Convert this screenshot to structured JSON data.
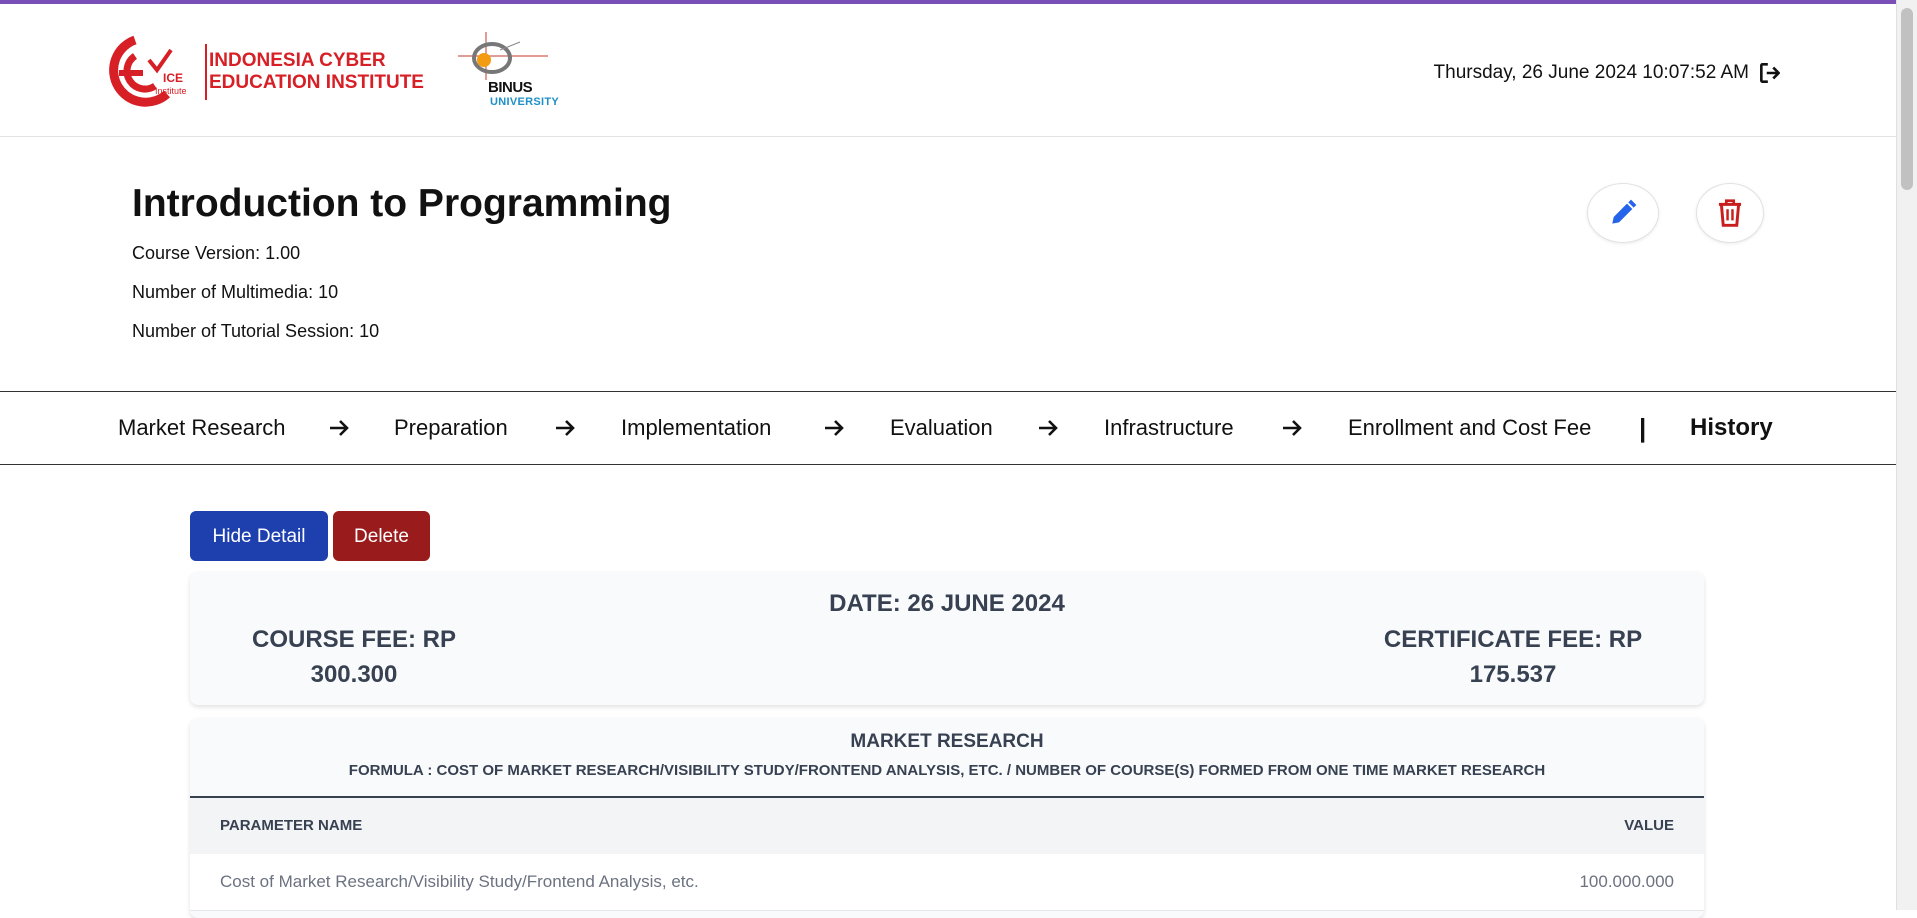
{
  "header": {
    "ice_logo": {
      "line1": "INDONESIA CYBER",
      "line2": "EDUCATION INSTITUTE",
      "mark_text_1": "ICE",
      "mark_text_2": "Institute"
    },
    "binus_logo": {
      "name": "BINUS",
      "sub": "UNIVERSITY"
    },
    "datetime": "Thursday, 26 June 2024 10:07:52 AM"
  },
  "course": {
    "title": "Introduction to Programming",
    "version": "Course Version: 1.00",
    "multimedia": "Number of Multimedia: 10",
    "tutorial": "Number of Tutorial Session: 10"
  },
  "actions": {
    "edit_icon": "pencil-icon",
    "delete_icon": "trash-icon"
  },
  "steps": [
    "Market Research",
    "Preparation",
    "Implementation",
    "Evaluation",
    "Infrastructure",
    "Enrollment and Cost Fee"
  ],
  "separator": "|",
  "history": "History",
  "buttons": {
    "hide_detail": "Hide Detail",
    "delete": "Delete"
  },
  "summary": {
    "date": "DATE: 26 JUNE 2024",
    "course_fee_line1": "COURSE FEE: RP",
    "course_fee_line2": "300.300",
    "certificate_fee_line1": "CERTIFICATE FEE: RP",
    "certificate_fee_line2": "175.537"
  },
  "market_research": {
    "title": "MARKET RESEARCH",
    "formula": "FORMULA : COST OF MARKET RESEARCH/VISIBILITY STUDY/FRONTEND ANALYSIS, ETC. / NUMBER OF COURSE(S) FORMED FROM ONE TIME MARKET RESEARCH",
    "columns": {
      "name": "PARAMETER NAME",
      "value": "VALUE"
    },
    "rows": [
      {
        "name": "Cost of Market Research/Visibility Study/Frontend Analysis, etc.",
        "value": "100.000.000"
      }
    ]
  },
  "colors": {
    "accent": "#7b4fb8",
    "brand_red": "#d71f26",
    "primary": "#1e40af",
    "danger": "#991b1b"
  }
}
